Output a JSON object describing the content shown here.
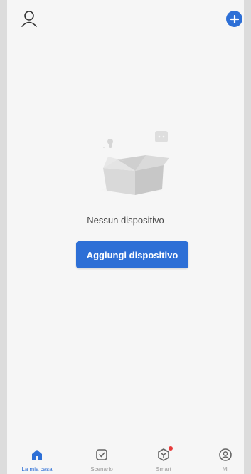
{
  "header": {
    "profile_icon": "person-icon",
    "add_icon": "plus-circle-icon"
  },
  "empty_state": {
    "illustration": "empty-box-illustration",
    "message": "Nessun dispositivo",
    "button_label": "Aggiungi dispositivo"
  },
  "tabs": [
    {
      "label": "La mia casa",
      "icon": "home-icon",
      "active": true
    },
    {
      "label": "Scenario",
      "icon": "scenario-check-icon",
      "active": false
    },
    {
      "label": "Smart",
      "icon": "smart-cube-icon",
      "active": false,
      "badge": true
    },
    {
      "label": "Mi",
      "icon": "account-circle-icon",
      "active": false
    }
  ],
  "colors": {
    "accent": "#2d6fd6",
    "badge": "#e63b3b",
    "background": "#f6f6f6"
  }
}
